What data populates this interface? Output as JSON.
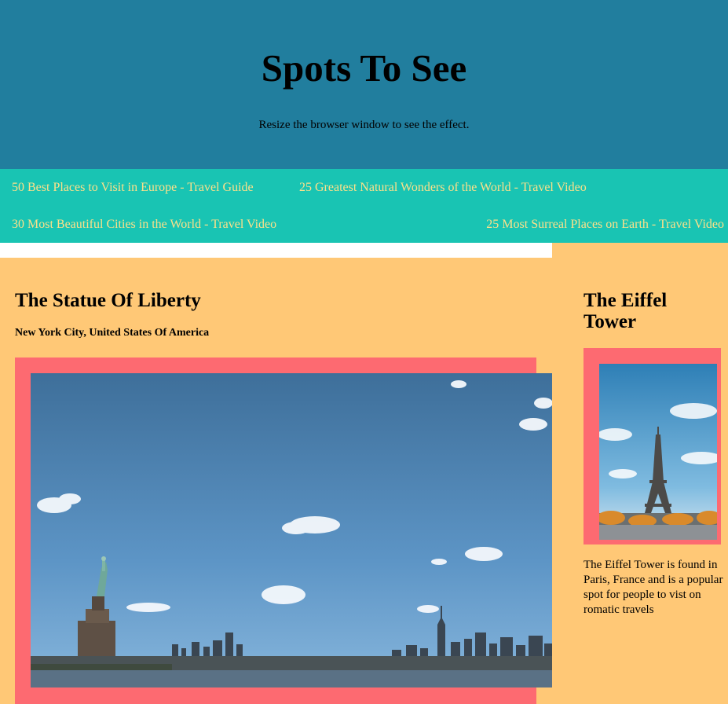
{
  "header": {
    "title": "Spots To See",
    "subtitle": "Resize the browser window to see the effect."
  },
  "nav": {
    "links": [
      "50 Best Places to Visit in Europe - Travel Guide",
      "25 Greatest Natural Wonders of the World - Travel Video",
      "30 Most Beautiful Cities in the World - Travel Video",
      "25 Most Surreal Places on Earth - Travel Video"
    ]
  },
  "main": {
    "title": "The Statue Of Liberty",
    "location": "New York City, United States Of America",
    "image_icon": "statue-of-liberty-photo"
  },
  "aside": {
    "title_line1": "The Eiffel",
    "title_line2": "Tower",
    "description": "The Eiffel Tower is found in Paris, France and is a popular spot for people to vist on romatic travels",
    "image_icon": "eiffel-tower-photo"
  },
  "colors": {
    "header_bg": "#217e9e",
    "nav_bg": "#19c4b3",
    "nav_link": "#fbe08a",
    "page_bg": "#ffc876",
    "frame": "#fd6a71"
  }
}
